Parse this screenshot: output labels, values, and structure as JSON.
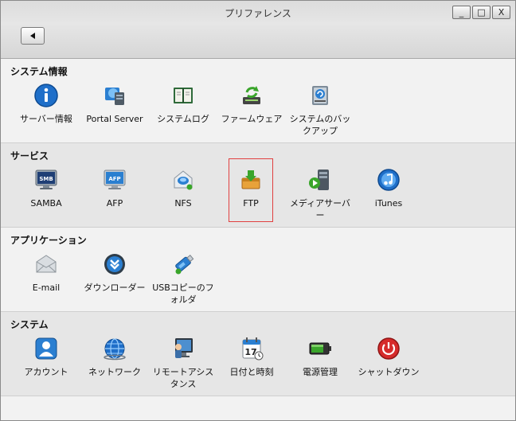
{
  "window": {
    "title": "プリファレンス",
    "minimize_label": "_",
    "maximize_label": "□",
    "close_label": "X"
  },
  "sections": [
    {
      "title": "システム情報",
      "items": [
        {
          "label": "サーバー情報",
          "icon": "info-icon"
        },
        {
          "label": "Portal Server",
          "icon": "portal-server-icon"
        },
        {
          "label": "システムログ",
          "icon": "log-book-icon"
        },
        {
          "label": "ファームウェア",
          "icon": "firmware-update-icon"
        },
        {
          "label": "システムのバックアップ",
          "icon": "backup-icon"
        }
      ]
    },
    {
      "title": "サービス",
      "items": [
        {
          "label": "SAMBA",
          "icon": "samba-icon",
          "badge": "SMB"
        },
        {
          "label": "AFP",
          "icon": "afp-icon",
          "badge": "AFP"
        },
        {
          "label": "NFS",
          "icon": "nfs-icon"
        },
        {
          "label": "FTP",
          "icon": "ftp-icon",
          "selected": true
        },
        {
          "label": "メディアサーバー",
          "icon": "media-server-icon"
        },
        {
          "label": "iTunes",
          "icon": "itunes-icon"
        }
      ]
    },
    {
      "title": "アプリケーション",
      "items": [
        {
          "label": "E-mail",
          "icon": "email-icon"
        },
        {
          "label": "ダウンローダー",
          "icon": "downloader-icon"
        },
        {
          "label": "USBコピーのフォルダ",
          "icon": "usb-copy-icon"
        }
      ]
    },
    {
      "title": "システム",
      "items": [
        {
          "label": "アカウント",
          "icon": "account-icon"
        },
        {
          "label": "ネットワーク",
          "icon": "network-icon"
        },
        {
          "label": "リモートアシスタンス",
          "icon": "remote-assistance-icon"
        },
        {
          "label": "日付と時刻",
          "icon": "calendar-icon",
          "badge": "17"
        },
        {
          "label": "電源管理",
          "icon": "battery-icon"
        },
        {
          "label": "シャットダウン",
          "icon": "power-icon"
        }
      ]
    }
  ],
  "colors": {
    "accent_blue": "#1f6fc9",
    "selection_border": "#e14040",
    "ftp_orange": "#e8a23a",
    "green": "#3aa52b",
    "red": "#d62b2b"
  }
}
